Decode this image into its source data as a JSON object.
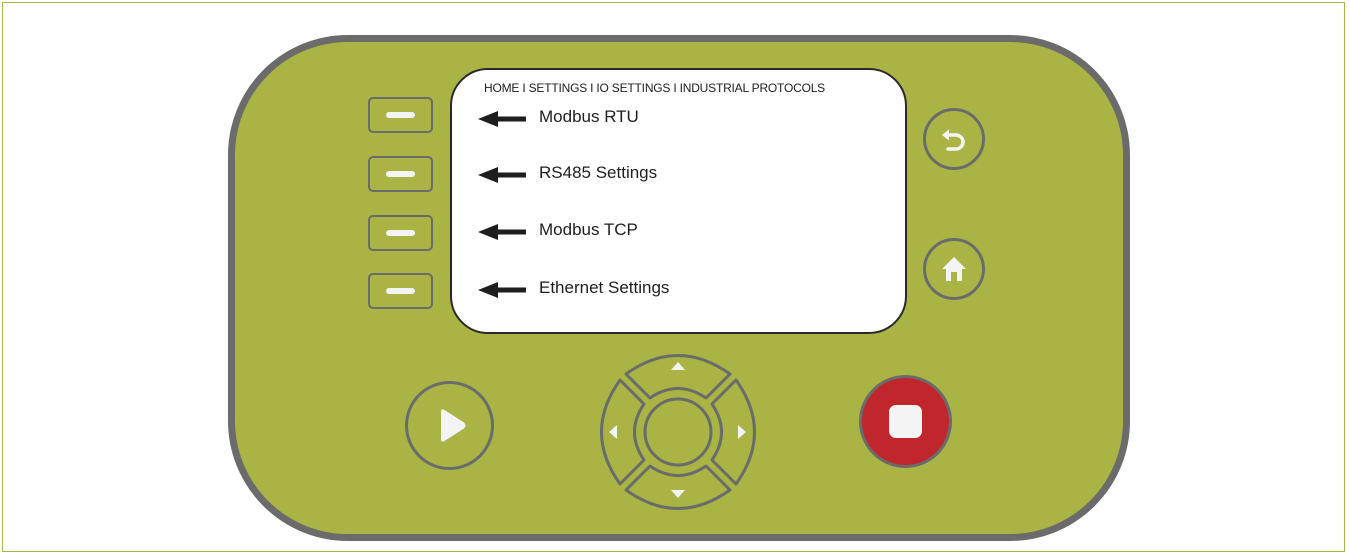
{
  "screen": {
    "breadcrumb": "HOME I SETTINGS I IO SETTINGS I INDUSTRIAL PROTOCOLS",
    "items": [
      {
        "label": "Modbus RTU"
      },
      {
        "label": "RS485 Settings"
      },
      {
        "label": "Modbus TCP"
      },
      {
        "label": "Ethernet Settings"
      }
    ]
  },
  "icons": {
    "soft_key": "minus-bar-icon",
    "menu_pointer": "left-arrow-icon",
    "back": "undo-arrow-icon",
    "home": "home-icon",
    "play": "play-icon",
    "stop": "stop-icon",
    "dpad": [
      "up-triangle-icon",
      "down-triangle-icon",
      "left-triangle-icon",
      "right-triangle-icon"
    ]
  },
  "colors": {
    "device_body": "#a9b445",
    "device_border": "#6b6b6b",
    "screen_background": "#ffffff",
    "stop_button": "#c0272d",
    "icon_fill": "#f4f4f4"
  }
}
